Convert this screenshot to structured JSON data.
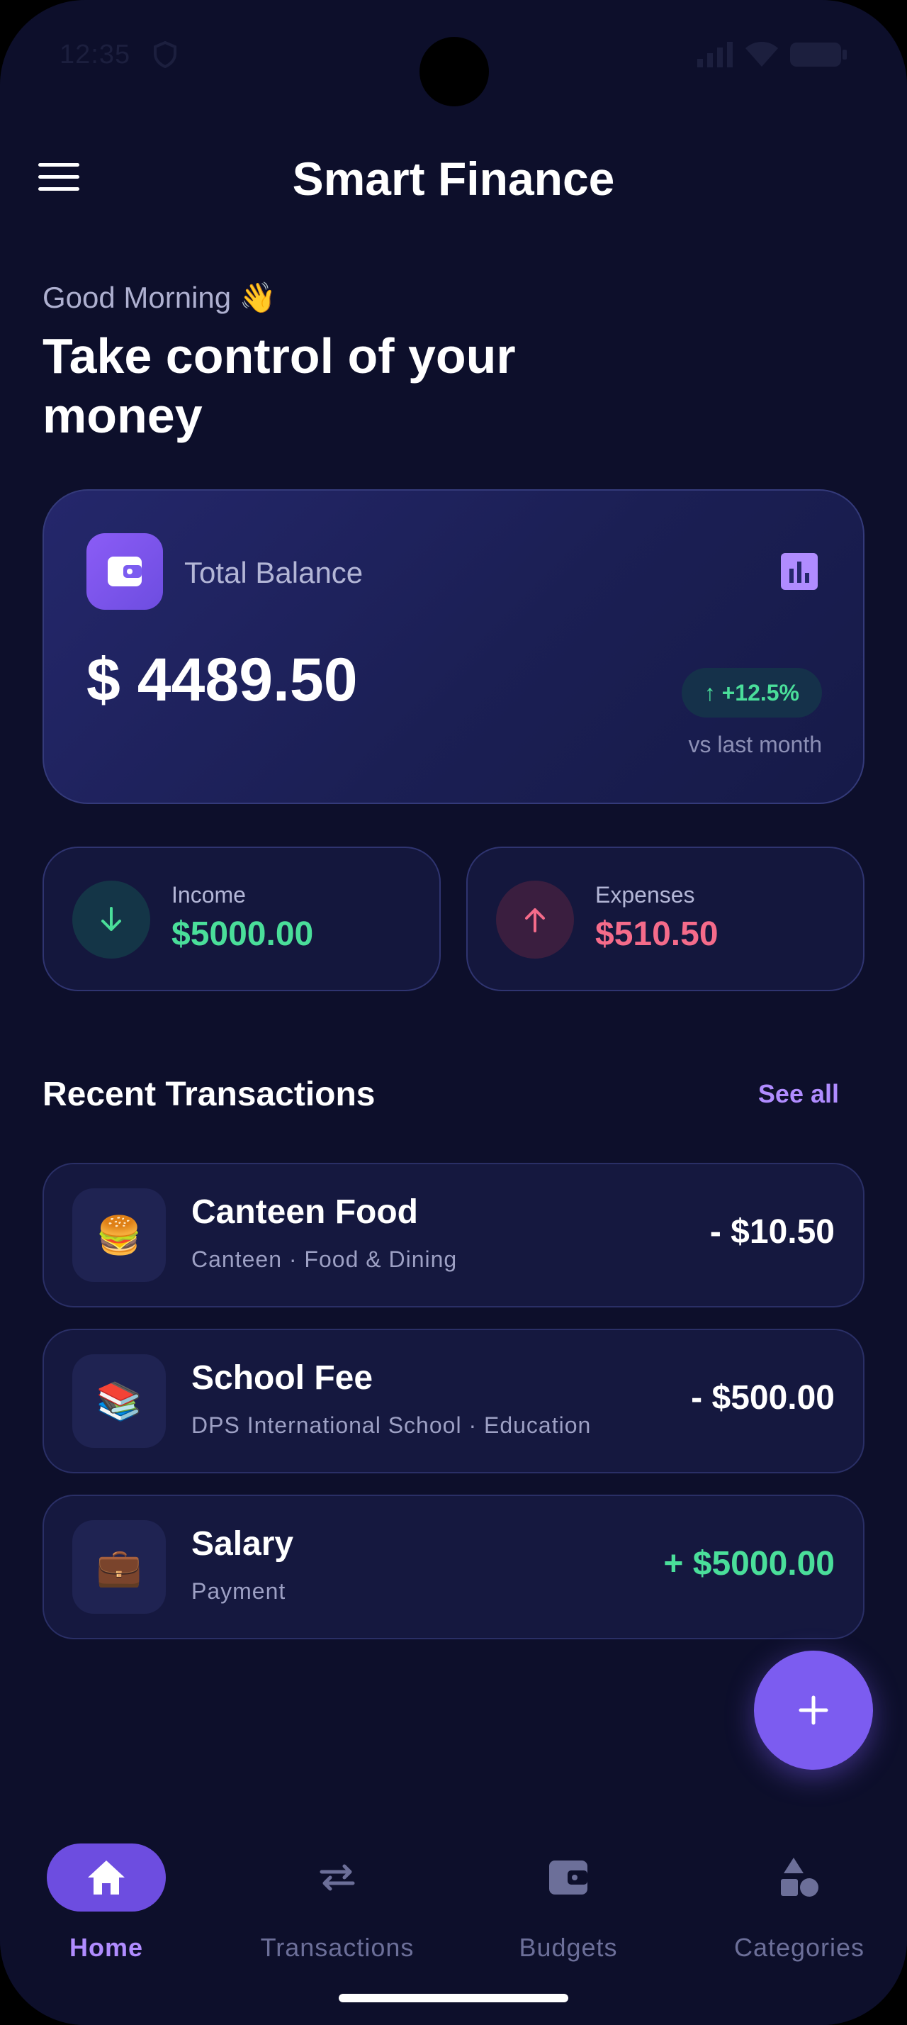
{
  "status_bar": {
    "time": "12:35"
  },
  "header": {
    "title": "Smart Finance"
  },
  "greeting": {
    "text": "Good Morning 👋",
    "headline": "Take control of your money"
  },
  "balance": {
    "label": "Total Balance",
    "amount": "$ 4489.50",
    "trend": "↑ +12.5%",
    "trend_caption": "vs last month"
  },
  "income": {
    "label": "Income",
    "value": "$5000.00",
    "color": "#4ade9a"
  },
  "expenses": {
    "label": "Expenses",
    "value": "$510.50",
    "color": "#f56b8a"
  },
  "recent": {
    "title": "Recent Transactions",
    "see_all": "See all",
    "items": [
      {
        "icon": "🍔",
        "icon_name": "burger-icon",
        "title": "Canteen Food",
        "subtitle": "Canteen · Food & Dining",
        "amount": "- $10.50"
      },
      {
        "icon": "📚",
        "icon_name": "books-icon",
        "title": "School Fee",
        "subtitle": "DPS International School · Education",
        "amount": "- $500.00"
      },
      {
        "icon": "💼",
        "icon_name": "briefcase-icon",
        "title": "Salary",
        "subtitle": "Payment",
        "amount": "+ $5000.00"
      }
    ]
  },
  "nav": {
    "items": [
      {
        "label": "Home",
        "icon": "home-icon",
        "active": true
      },
      {
        "label": "Transactions",
        "icon": "swap-icon",
        "active": false
      },
      {
        "label": "Budgets",
        "icon": "wallet-icon",
        "active": false
      },
      {
        "label": "Categories",
        "icon": "shapes-icon",
        "active": false
      }
    ]
  },
  "colors": {
    "background": "#0d0f2b",
    "accent": "#7c5cf0",
    "positive": "#4ade9a",
    "negative": "#f56b8a"
  }
}
